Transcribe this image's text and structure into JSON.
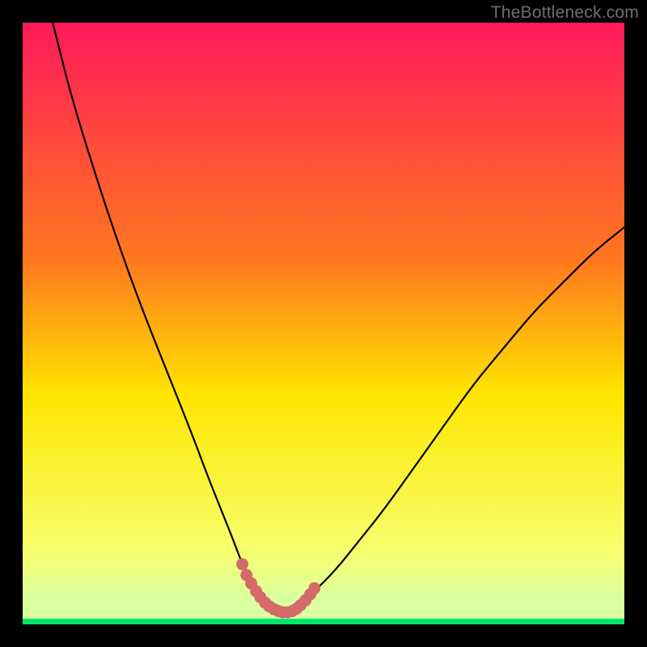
{
  "watermark": "TheBottleneck.com",
  "colors": {
    "frame": "#000000",
    "watermark": "#6f6f6f",
    "gradient_top": "#ff1a5a",
    "gradient_upper": "#ff7a1e",
    "gradient_mid": "#ffe600",
    "gradient_low": "#f7ff6e",
    "gradient_bottom_band": "#d9ffa0",
    "gradient_bottom_line": "#00e86b",
    "curve": "#000000",
    "marker": "#d46a6a"
  },
  "chart_data": {
    "type": "line",
    "title": "",
    "xlabel": "",
    "ylabel": "",
    "xlim": [
      0,
      100
    ],
    "ylim": [
      0,
      100
    ],
    "series": [
      {
        "name": "curve",
        "x": [
          5,
          8,
          12,
          16,
          20,
          24,
          28,
          31,
          33,
          35,
          36.5,
          38,
          39,
          40,
          41,
          42,
          43,
          44,
          46,
          48,
          52,
          56,
          60,
          65,
          70,
          75,
          80,
          85,
          90,
          95,
          100
        ],
        "y": [
          100,
          88,
          75,
          63,
          52,
          42,
          32,
          24,
          19,
          14,
          10,
          7,
          5,
          3.5,
          2.5,
          2,
          2,
          2.5,
          3.5,
          5,
          9,
          14,
          19,
          26,
          33,
          40,
          46,
          52,
          57,
          62,
          66
        ]
      },
      {
        "name": "markers",
        "x": [
          36.5,
          37.2,
          38,
          38.8,
          39.5,
          40.3,
          41,
          41.8,
          42.5,
          43.2,
          44,
          44.8,
          45.5,
          46.2,
          47,
          47.8,
          48.5
        ],
        "y": [
          10,
          8.2,
          6.8,
          5.5,
          4.5,
          3.6,
          3,
          2.5,
          2.2,
          2,
          2,
          2.2,
          2.6,
          3.2,
          4,
          5,
          6
        ]
      }
    ],
    "gradient_bands": [
      {
        "y": 100,
        "color": "#ff1a5a"
      },
      {
        "y": 60,
        "color": "#ff7a1e"
      },
      {
        "y": 38,
        "color": "#ffe600"
      },
      {
        "y": 12,
        "color": "#f7ff6e"
      },
      {
        "y": 5,
        "color": "#d9ffa0"
      },
      {
        "y": 0,
        "color": "#00e86b"
      }
    ]
  }
}
